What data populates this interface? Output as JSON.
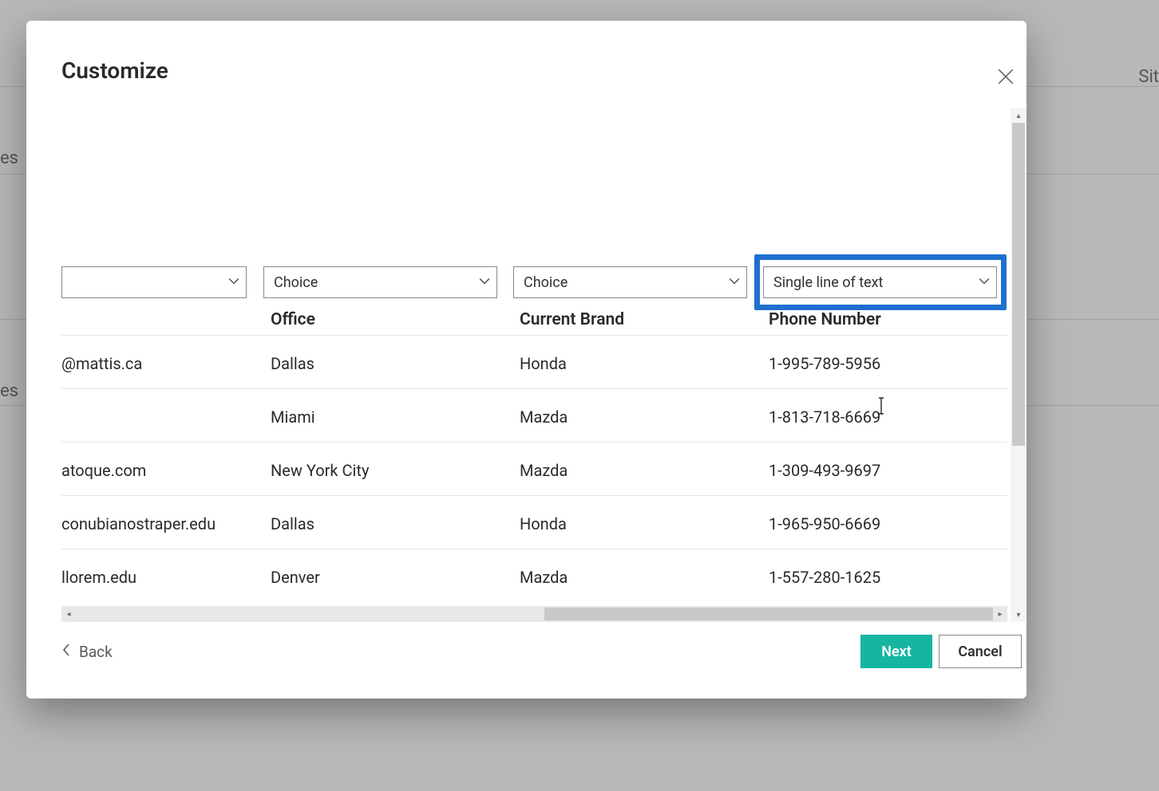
{
  "background": {
    "text_sit": "Sit",
    "text_es1": "es",
    "text_es2": "es"
  },
  "dialog": {
    "title": "Customize",
    "close_label": "Close",
    "dropdowns": {
      "col0": "",
      "col1": "Choice",
      "col2": "Choice",
      "col3": "Single line of text"
    },
    "columns": {
      "email_fragment_header": "",
      "office": "Office",
      "current_brand": "Current Brand",
      "phone_number": "Phone Number"
    },
    "rows": [
      {
        "email": "@mattis.ca",
        "office": "Dallas",
        "brand": "Honda",
        "phone": "1-995-789-5956"
      },
      {
        "email": "",
        "office": "Miami",
        "brand": "Mazda",
        "phone": "1-813-718-6669"
      },
      {
        "email": "atoque.com",
        "office": "New York City",
        "brand": "Mazda",
        "phone": "1-309-493-9697"
      },
      {
        "email": "conubianostraper.edu",
        "office": "Dallas",
        "brand": "Honda",
        "phone": "1-965-950-6669"
      },
      {
        "email": "llorem.edu",
        "office": "Denver",
        "brand": "Mazda",
        "phone": "1-557-280-1625"
      }
    ],
    "footer": {
      "back": "Back",
      "next": "Next",
      "cancel": "Cancel"
    }
  }
}
